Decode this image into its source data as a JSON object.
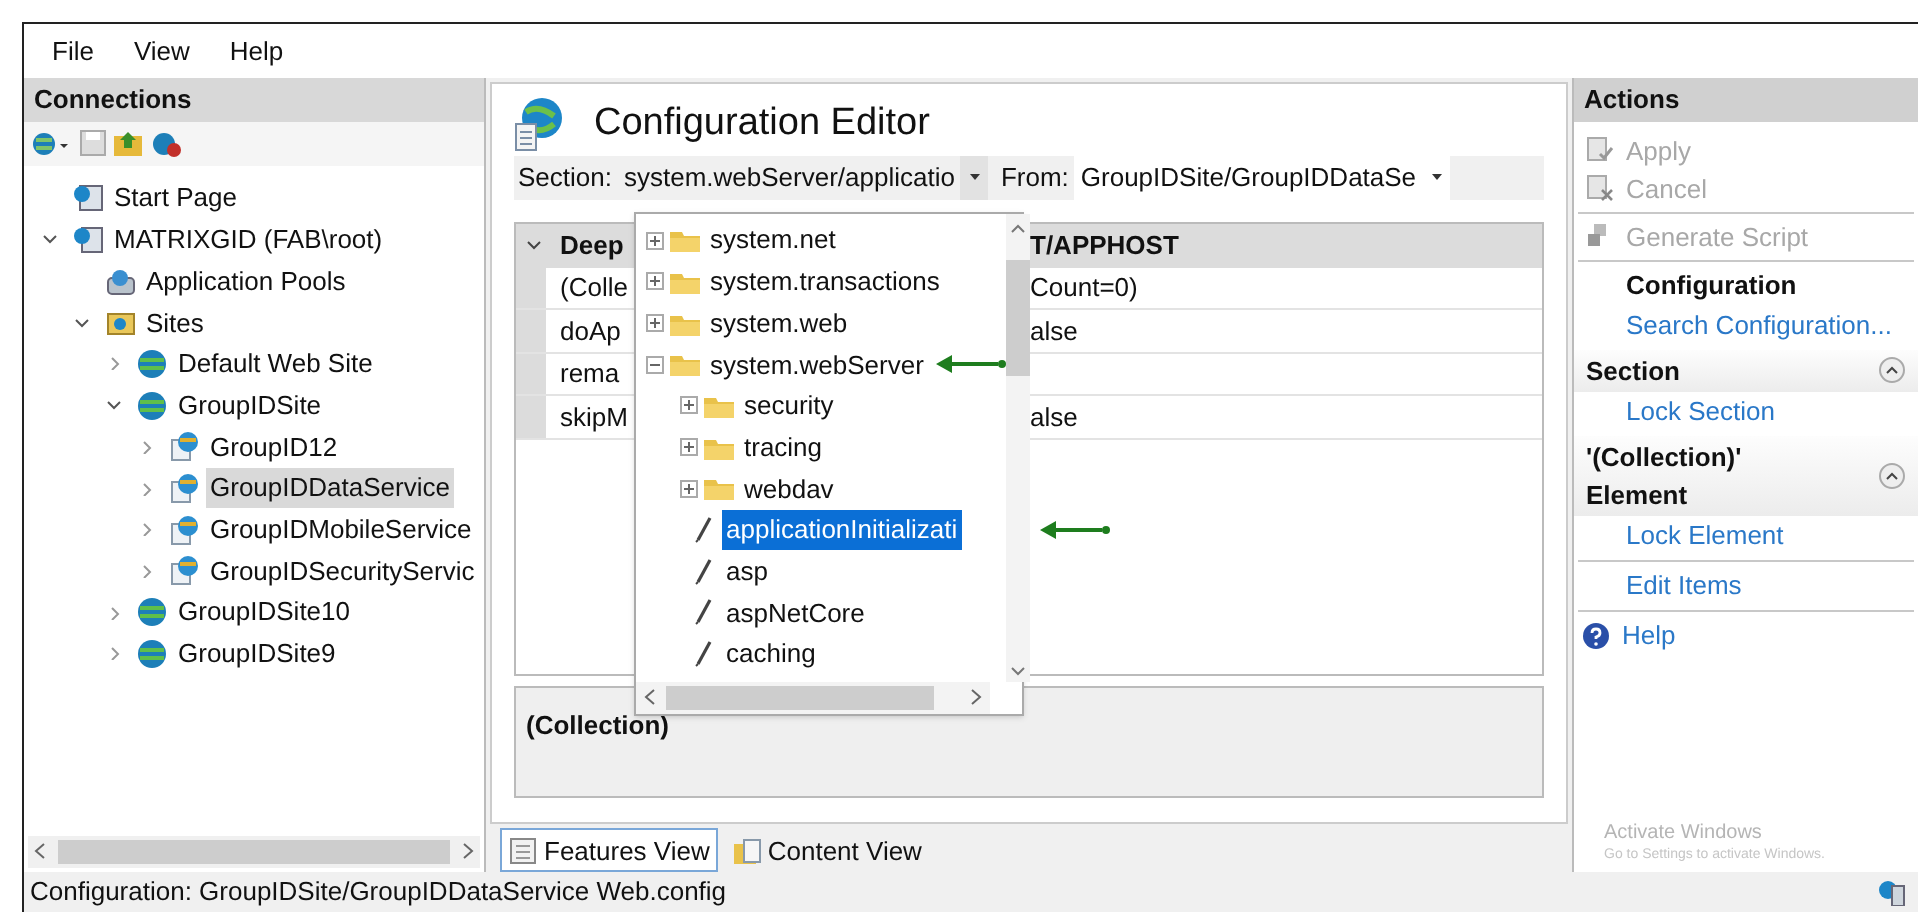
{
  "menu": [
    "File",
    "View",
    "Help"
  ],
  "connections": {
    "title": "Connections",
    "tree": [
      {
        "label": "Start Page",
        "kind": "start",
        "selected": false
      },
      {
        "label": "MATRIXGID (FAB\\root)",
        "kind": "server",
        "expanded": true,
        "selected": false,
        "children": [
          {
            "label": "Application Pools",
            "kind": "pools",
            "selected": false
          },
          {
            "label": "Sites",
            "kind": "sites",
            "expanded": true,
            "selected": false,
            "children": [
              {
                "label": "Default Web Site",
                "kind": "site",
                "expanded": false,
                "selected": false
              },
              {
                "label": "GroupIDSite",
                "kind": "site",
                "expanded": true,
                "selected": false,
                "children": [
                  {
                    "label": "GroupID12",
                    "kind": "app",
                    "expanded": false,
                    "selected": false
                  },
                  {
                    "label": "GroupIDDataService",
                    "kind": "app",
                    "expanded": false,
                    "selected": true
                  },
                  {
                    "label": "GroupIDMobileService",
                    "kind": "app",
                    "expanded": false,
                    "selected": false
                  },
                  {
                    "label": "GroupIDSecurityServic",
                    "kind": "app",
                    "expanded": false,
                    "selected": false
                  }
                ]
              },
              {
                "label": "GroupIDSite10",
                "kind": "site",
                "expanded": false,
                "selected": false
              },
              {
                "label": "GroupIDSite9",
                "kind": "site",
                "expanded": false,
                "selected": false
              }
            ]
          }
        ]
      }
    ]
  },
  "editor": {
    "title": "Configuration Editor",
    "section_label": "Section:",
    "section_value": "system.webServer/applicatio",
    "from_label": "From:",
    "from_value": "GroupIDSite/GroupIDDataSe",
    "grid": {
      "header": [
        "Deep",
        "T/APPHOST"
      ],
      "rows": [
        {
          "name": "(Colle",
          "value": "Count=0)"
        },
        {
          "name": "doAp",
          "value": "alse"
        },
        {
          "name": "rema"
        },
        {
          "name": "skipM",
          "value": "alse"
        }
      ]
    },
    "detail": "(Collection)",
    "section_dropdown": [
      {
        "label": "system.net",
        "kind": "folder",
        "expanded": false,
        "selected": false
      },
      {
        "label": "system.transactions",
        "kind": "folder",
        "expanded": false,
        "selected": false
      },
      {
        "label": "system.web",
        "kind": "folder",
        "expanded": false,
        "selected": false
      },
      {
        "label": "system.webServer",
        "kind": "folder",
        "expanded": true,
        "selected": false,
        "arrow": true,
        "children": [
          {
            "label": "security",
            "kind": "folder",
            "expanded": false,
            "selected": false
          },
          {
            "label": "tracing",
            "kind": "folder",
            "expanded": false,
            "selected": false
          },
          {
            "label": "webdav",
            "kind": "folder",
            "expanded": false,
            "selected": false
          },
          {
            "label": "applicationInitializati",
            "kind": "section",
            "selected": true,
            "arrow": true
          },
          {
            "label": "asp",
            "kind": "section",
            "selected": false
          },
          {
            "label": "aspNetCore",
            "kind": "section",
            "selected": false
          },
          {
            "label": "caching",
            "kind": "section",
            "selected": false
          }
        ]
      }
    ]
  },
  "view_tabs": [
    {
      "label": "Features View",
      "selected": true
    },
    {
      "label": "Content View",
      "selected": false
    }
  ],
  "actions": {
    "title": "Actions",
    "items": [
      {
        "kind": "action",
        "label": "Apply",
        "disabled": true
      },
      {
        "kind": "action",
        "label": "Cancel",
        "disabled": true
      },
      {
        "kind": "separator"
      },
      {
        "kind": "action",
        "label": "Generate Script",
        "disabled": true
      },
      {
        "kind": "separator"
      },
      {
        "kind": "heading",
        "label": "Configuration"
      },
      {
        "kind": "link",
        "label": "Search Configuration..."
      },
      {
        "kind": "group",
        "label": "Section",
        "expanded": true
      },
      {
        "kind": "link",
        "label": "Lock Section"
      },
      {
        "kind": "group",
        "label": "'(Collection)' Element",
        "expanded": true
      },
      {
        "kind": "link",
        "label": "Lock Element"
      },
      {
        "kind": "separator"
      },
      {
        "kind": "link",
        "label": "Edit Items"
      },
      {
        "kind": "separator"
      },
      {
        "kind": "help",
        "label": "Help"
      }
    ],
    "activation_notice": [
      "Activate Windows",
      "Go to Settings to activate Windows."
    ]
  },
  "status_bar": "Configuration: GroupIDSite/GroupIDDataService Web.config"
}
